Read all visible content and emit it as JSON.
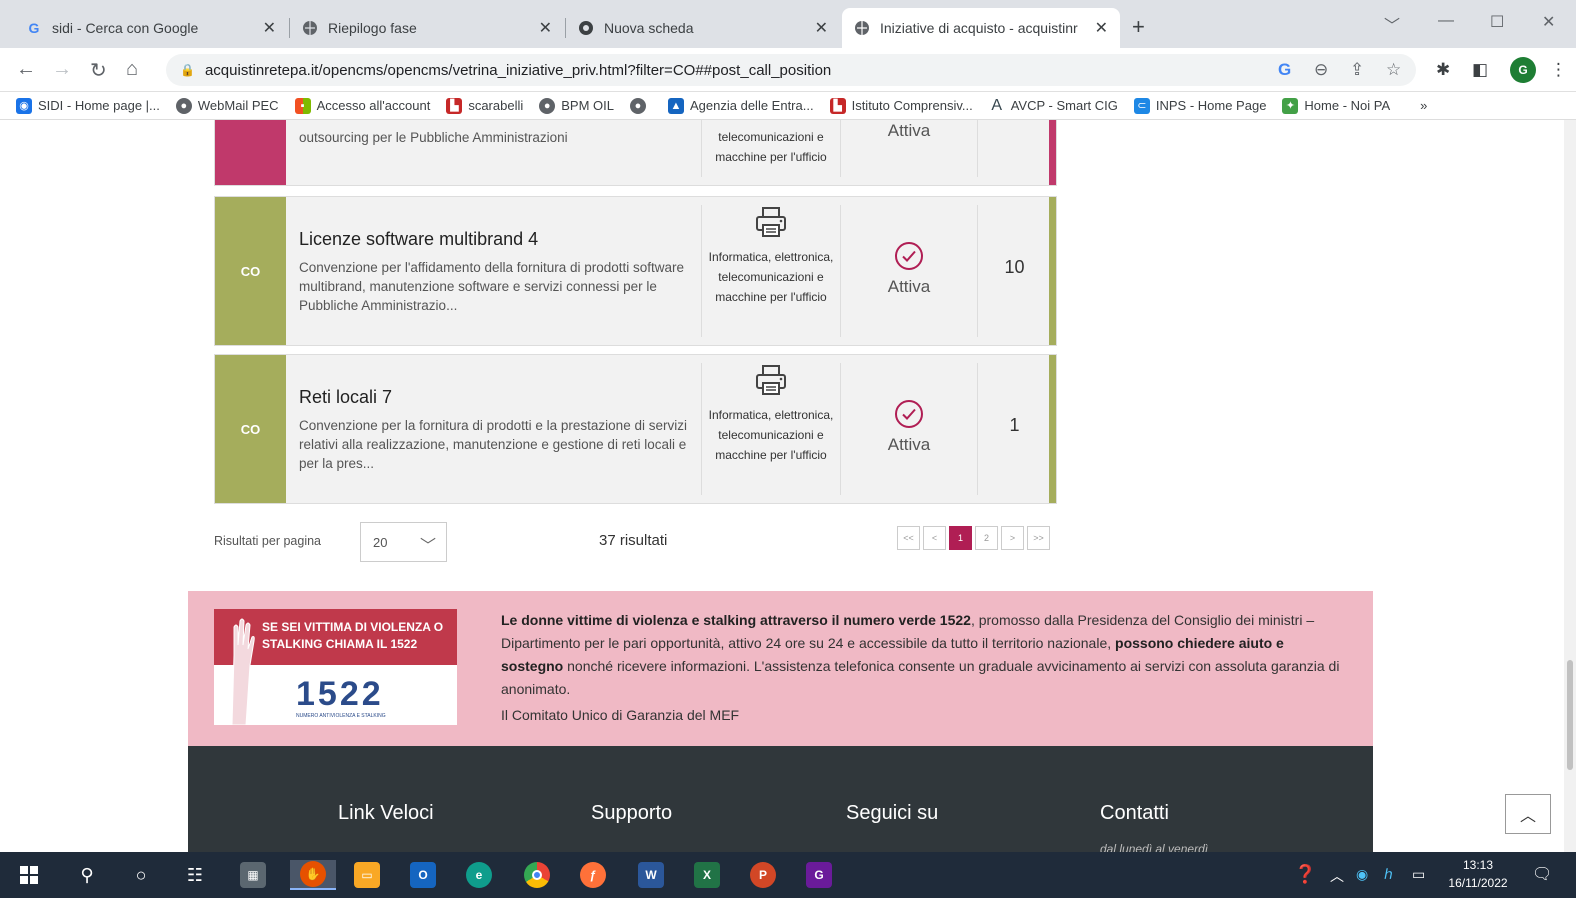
{
  "browser": {
    "tabs": [
      {
        "title": "sidi - Cerca con Google",
        "icon": "google-icon",
        "active": false
      },
      {
        "title": "Riepilogo fase",
        "icon": "globe-icon",
        "active": false
      },
      {
        "title": "Nuova scheda",
        "icon": "chrome-icon",
        "active": false
      },
      {
        "title": "Iniziative di acquisto - acquistinr",
        "icon": "globe-icon",
        "active": true
      }
    ],
    "url": "acquistinretepa.it/opencms/opencms/vetrina_iniziative_priv.html?filter=CO##post_call_position",
    "profile_initial": "G",
    "bookmarks": [
      {
        "label": "SIDI - Home page |...",
        "color": "#1a73e8"
      },
      {
        "label": "WebMail PEC",
        "color": "#5f6368"
      },
      {
        "label": "Accesso all'account",
        "color": "#f25022"
      },
      {
        "label": "scarabelli",
        "color": "#c62828"
      },
      {
        "label": "BPM OIL",
        "color": "#5f6368"
      },
      {
        "label": "",
        "color": "#5f6368"
      },
      {
        "label": "Agenzia delle Entra...",
        "color": "#1565c0"
      },
      {
        "label": "Istituto Comprensiv...",
        "color": "#c62828"
      },
      {
        "label": "AVCP - Smart CIG",
        "color": "#37474f"
      },
      {
        "label": "INPS - Home Page",
        "color": "#1e88e5"
      },
      {
        "label": "Home - Noi PA",
        "color": "#43a047"
      }
    ],
    "bookmarks_more": "»"
  },
  "colors": {
    "accent_magenta": "#c0396b",
    "accent_olive": "#a5ad5c",
    "pager_active": "#b01e54",
    "pink_banner": "#f0b9c5",
    "footer_bg": "#30373b"
  },
  "initiatives": [
    {
      "type": "",
      "title": "",
      "description": "outsourcing per le Pubbliche Amministrazioni",
      "category": "telecomunicazioni e macchine per l'ufficio",
      "status": "Attiva",
      "count": ""
    },
    {
      "type": "CO",
      "title": "Licenze software multibrand 4",
      "description": "Convenzione per l'affidamento della fornitura di prodotti software multibrand, manutenzione software e servizi connessi per le Pubbliche Amministrazio...",
      "category": "Informatica, elettronica, telecomunicazioni e macchine per l'ufficio",
      "status": "Attiva",
      "count": "10"
    },
    {
      "type": "CO",
      "title": "Reti locali 7",
      "description": "Convenzione per la fornitura di prodotti e la prestazione di servizi relativi alla realizzazione, manutenzione e gestione di reti locali e per la pres...",
      "category": "Informatica, elettronica, telecomunicazioni e macchine per l'ufficio",
      "status": "Attiva",
      "count": "1"
    }
  ],
  "pagination": {
    "results_per_page_label": "Risultati per pagina",
    "results_per_page_value": "20",
    "results_count": "37 risultati",
    "pages": [
      "<<",
      "<",
      "1",
      "2",
      ">",
      ">>"
    ],
    "current_page": "1"
  },
  "violence_banner": {
    "image_text": "SE SEI VITTIMA DI VIOLENZA O STALKING CHIAMA IL 1522",
    "image_number": "1522",
    "image_small": "NUMERO ANTIVIOLENZA E STALKING",
    "text_bold_1": "Le donne vittime di violenza e stalking attraverso il numero verde 1522",
    "text_1": ", promosso dalla Presidenza del Consiglio dei ministri – Dipartimento per le pari opportunità, attivo 24 ore su 24 e accessibile da tutto il territorio nazionale, ",
    "text_bold_2": "possono chiedere aiuto e sostegno",
    "text_2": " nonché ricevere informazioni. L'assistenza telefonica consente un graduale avvicinamento ai servizi con assoluta garanzia di anonimato.",
    "signature": "Il Comitato Unico di Garanzia del MEF"
  },
  "footer": {
    "headings": [
      "Link Veloci",
      "Supporto",
      "Seguici su",
      "Contatti"
    ],
    "contatti_sub": "dal lunedì al venerdì"
  },
  "taskbar": {
    "time": "13:13",
    "date": "16/11/2022"
  }
}
